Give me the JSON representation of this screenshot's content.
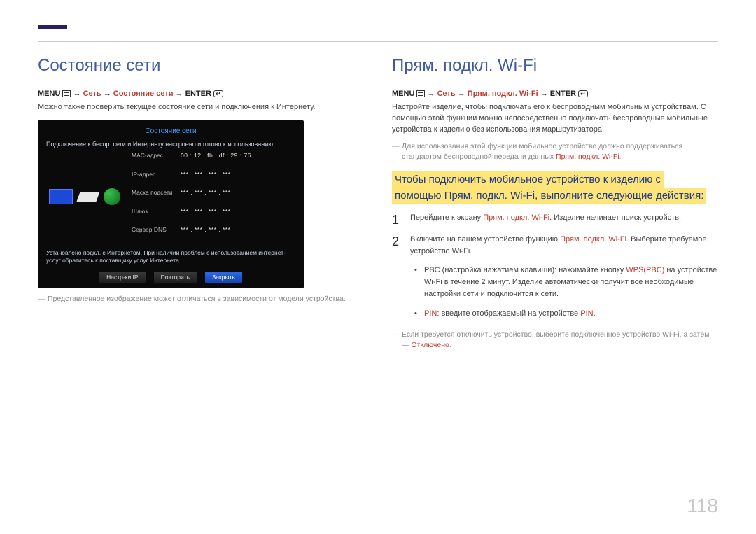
{
  "left": {
    "heading": "Состояние сети",
    "menu_label": "MENU",
    "arrow": "→",
    "path_net": "Сеть",
    "path_item": "Состояние сети",
    "enter_label": "ENTER",
    "desc": "Можно также проверить текущее состояние сети и подключения к Интернету.",
    "mock": {
      "title": "Состояние сети",
      "topline": "Подключение к беспр. сети и Интернету настроено и готово к использованию.",
      "rows": {
        "mac_label": "MAC-адрес",
        "mac_val": "00 : 12 : fb : df : 29 : 76",
        "ip_label": "IP-адрес",
        "ip_val": "*** . *** . *** . ***",
        "mask_label": "Маска подсети",
        "mask_val": "*** . *** . *** . ***",
        "gw_label": "Шлюз",
        "gw_val": "*** . *** . *** . ***",
        "dns_label": "Сервер DNS",
        "dns_val": "*** . *** . *** . ***"
      },
      "msg": "Установлено подкл. с Интернетом. При наличии проблем с использованием интернет-услуг обратитесь к поставщику услуг Интернета.",
      "btn_ip": "Настр-ки IP",
      "btn_retry": "Повторить",
      "btn_close": "Закрыть"
    },
    "caption": "Представленное изображение может отличаться в зависимости от модели устройства."
  },
  "right": {
    "heading": "Прям. подкл. Wi-Fi",
    "menu_label": "MENU",
    "arrow": "→",
    "path_net": "Сеть",
    "path_item": "Прям. подкл. Wi-Fi",
    "enter_label": "ENTER",
    "desc": "Настройте изделие, чтобы подключать его к беспроводным мобильным устройствам. С помощью этой функции можно непосредственно подключать беспроводные мобильные устройства к изделию без использования маршрутизатора.",
    "note1_a": "Для использования этой функции мобильное устройство должно поддерживаться стандартом беспроводной передачи данных ",
    "note1_b": "Прям. подкл. Wi-Fi",
    "highlight_a": "Чтобы подключить мобильное устройство к изделию с",
    "highlight_b": "помощью Прям. подкл. Wi-Fi, выполните следующие действия:",
    "step1_a": "Перейдите к экрану ",
    "step1_b": "Прям. подкл. Wi-Fi",
    "step1_c": ". Изделие начинает поиск устройств.",
    "step2_a": "Включите на вашем устройстве функцию ",
    "step2_b": "Прям. подкл. Wi-Fi",
    "step2_c": ". Выберите требуемое устройство Wi-Fi.",
    "bullet_pbc_a": "PBC (настройка нажатием клавиши): нажимайте кнопку ",
    "bullet_pbc_b": "WPS(PBC)",
    "bullet_pbc_c": " на устройстве Wi-Fi в течение 2 минут. Изделие автоматически получит все необходимые настройки сети и подключится к сети.",
    "bullet_pin_a": "PIN",
    "bullet_pin_b": ": введите отображаемый на устройстве ",
    "bullet_pin_c": "PIN",
    "note2_a": "Если требуется отключить устройство, выберите подключенное устройство Wi-Fi, а затем — ",
    "note2_b": "Отключено",
    "note2_c": "."
  },
  "page_number": "118"
}
